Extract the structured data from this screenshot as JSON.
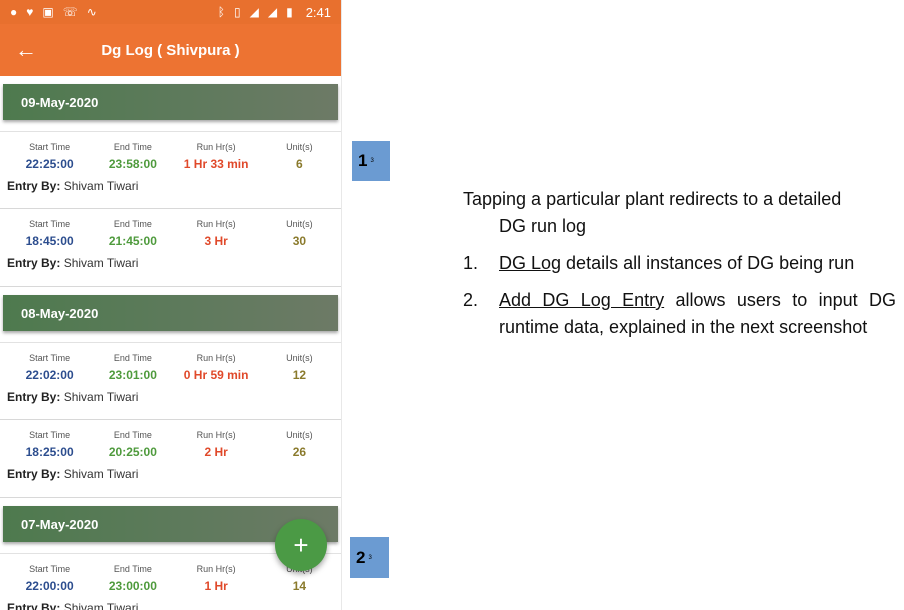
{
  "status_bar": {
    "time": "2:41",
    "icons": [
      "spotify-icon",
      "heart-icon",
      "image-icon",
      "phone-icon",
      "activity-icon",
      "bluetooth-icon",
      "vibrate-icon",
      "lte-call-icon",
      "signal-icon",
      "lte-signal-icon",
      "battery-icon"
    ]
  },
  "app_bar": {
    "title": "Dg Log ( Shivpura )",
    "back_icon": "arrow-left-icon",
    "background": "#ED7332"
  },
  "labels": {
    "start": "Start Time",
    "end": "End Time",
    "run": "Run Hr(s)",
    "unit": "Unit(s)",
    "entry_by": "Entry By:"
  },
  "groups": [
    {
      "date": "09-May-2020",
      "entries": [
        {
          "start": "22:25:00",
          "end": "23:58:00",
          "run": "1 Hr 33 min",
          "units": "6",
          "by": "Shivam Tiwari"
        },
        {
          "start": "18:45:00",
          "end": "21:45:00",
          "run": "3 Hr",
          "units": "30",
          "by": "Shivam Tiwari"
        }
      ]
    },
    {
      "date": "08-May-2020",
      "entries": [
        {
          "start": "22:02:00",
          "end": "23:01:00",
          "run": "0 Hr 59 min",
          "units": "12",
          "by": "Shivam Tiwari"
        },
        {
          "start": "18:25:00",
          "end": "20:25:00",
          "run": "2 Hr",
          "units": "26",
          "by": "Shivam Tiwari"
        }
      ]
    },
    {
      "date": "07-May-2020",
      "entries": [
        {
          "start": "22:00:00",
          "end": "23:00:00",
          "run": "1 Hr",
          "units": "14",
          "by": "Shivam Tiwari"
        }
      ]
    }
  ],
  "fab": {
    "label": "+",
    "icon": "plus-icon",
    "color": "#4B9A45"
  },
  "markers": [
    {
      "num": "1",
      "sup": "3"
    },
    {
      "num": "2",
      "sup": "3"
    }
  ],
  "annotation": {
    "intro_line1": "Tapping a particular plant redirects to a detailed",
    "intro_line2": "DG run log",
    "items": [
      {
        "num": "1.",
        "link": "DG Log",
        "rest": " details all instances of DG being run"
      },
      {
        "num": "2.",
        "link": "Add DG Log Entry",
        "rest": " allows users to input DG runtime data, explained in the next screenshot"
      }
    ]
  }
}
